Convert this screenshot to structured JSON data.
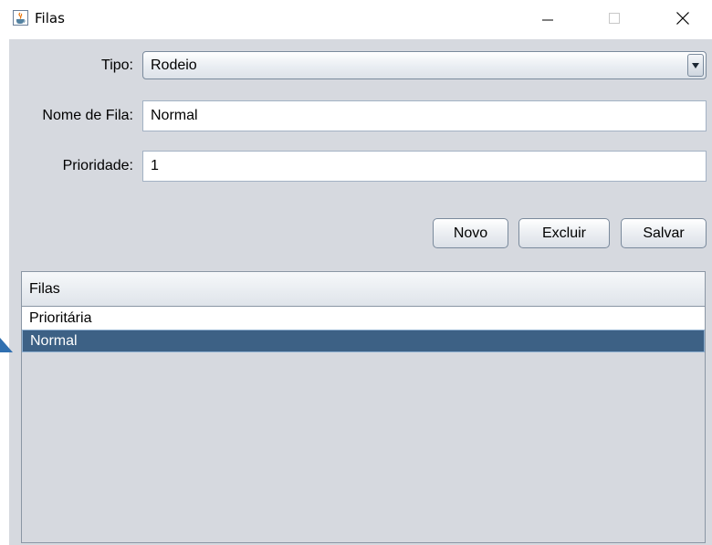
{
  "window": {
    "title": "Filas",
    "icon": "java-cup-icon",
    "controls": [
      "minimize",
      "maximize",
      "close"
    ]
  },
  "form": {
    "tipo_label": "Tipo:",
    "tipo_value": "Rodeio",
    "nome_label": "Nome de Fila:",
    "nome_value": "Normal",
    "prioridade_label": "Prioridade:",
    "prioridade_value": "1"
  },
  "buttons": {
    "novo": "Novo",
    "excluir": "Excluir",
    "salvar": "Salvar"
  },
  "table": {
    "header": "Filas",
    "rows": [
      "Prioritária",
      "Normal"
    ],
    "selected_index": 1
  },
  "colors": {
    "panel_bg": "#d6d9df",
    "selection_bg": "#3d6185",
    "selection_fg": "#ffffff"
  }
}
